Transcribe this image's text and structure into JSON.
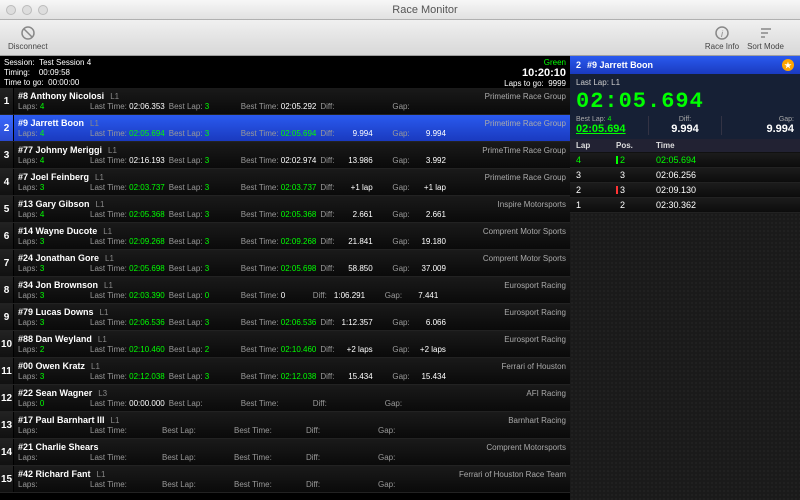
{
  "app": {
    "title": "Race Monitor"
  },
  "toolbar": {
    "disconnect": "Disconnect",
    "raceInfo": "Race Info",
    "sortMode": "Sort Mode"
  },
  "session": {
    "nameLbl": "Session:",
    "name": "Test Session 4",
    "timingLbl": "Timing:",
    "timing": "00:09:58",
    "ttgLbl": "Time to go:",
    "ttg": "00:00:00",
    "flag": "Green",
    "clock": "10:20:10",
    "lapsToGoLbl": "Laps to go:",
    "lapsToGo": "9999"
  },
  "cols": {
    "laps": "Laps:",
    "lastTime": "Last Time:",
    "bestLap": "Best Lap:",
    "bestTime": "Best Time:",
    "diff": "Diff:",
    "gap": "Gap:"
  },
  "rows": [
    {
      "pos": "1",
      "num": "#8",
      "driver": "Anthony Nicolosi",
      "l": "L1",
      "team": "Primetime Race Group",
      "laps": "4",
      "lt": "02:06.353",
      "bl": "3",
      "bt": "02:05.292",
      "diff": "",
      "gap": ""
    },
    {
      "pos": "2",
      "num": "#9",
      "driver": "Jarrett Boon",
      "l": "L1",
      "team": "Primetime Race Group",
      "laps": "4",
      "lt": "02:05.694",
      "ltG": true,
      "bl": "3",
      "bt": "02:05.694",
      "btG": true,
      "diff": "9.994",
      "gap": "9.994",
      "sel": true
    },
    {
      "pos": "3",
      "num": "#77",
      "driver": "Johnny Meriggi",
      "l": "L1",
      "team": "PrimeTime Race Group",
      "laps": "4",
      "lt": "02:16.193",
      "bl": "3",
      "bt": "02:02.974",
      "diff": "13.986",
      "gap": "3.992"
    },
    {
      "pos": "4",
      "num": "#7",
      "driver": "Joel Feinberg",
      "l": "L1",
      "team": "Primetime Race Group",
      "laps": "3",
      "lt": "02:03.737",
      "ltG": true,
      "bl": "3",
      "bt": "02:03.737",
      "btG": true,
      "diff": "+1 lap",
      "gap": "+1 lap"
    },
    {
      "pos": "5",
      "num": "#13",
      "driver": "Gary Gibson",
      "l": "L1",
      "team": "Inspire Motorsports",
      "laps": "4",
      "lt": "02:05.368",
      "ltG": true,
      "bl": "3",
      "bt": "02:05.368",
      "btG": true,
      "diff": "2.661",
      "gap": "2.661"
    },
    {
      "pos": "6",
      "num": "#14",
      "driver": "Wayne Ducote",
      "l": "L1",
      "team": "Comprent Motor Sports",
      "laps": "3",
      "lt": "02:09.268",
      "ltG": true,
      "bl": "3",
      "bt": "02:09.268",
      "btG": true,
      "diff": "21.841",
      "gap": "19.180"
    },
    {
      "pos": "7",
      "num": "#24",
      "driver": "Jonathan Gore",
      "l": "L1",
      "team": "Comprent Motor Sports",
      "laps": "3",
      "lt": "02:05.698",
      "ltG": true,
      "bl": "3",
      "bt": "02:05.698",
      "btG": true,
      "diff": "58.850",
      "gap": "37.009"
    },
    {
      "pos": "8",
      "num": "#34",
      "driver": "Jon Brownson",
      "l": "L1",
      "team": "Eurosport Racing",
      "laps": "3",
      "lt": "02:03.390",
      "ltG": true,
      "bl": "0",
      "bt": "0",
      "diff": "1:06.291",
      "gap": "7.441"
    },
    {
      "pos": "9",
      "num": "#79",
      "driver": "Lucas Downs",
      "l": "L1",
      "team": "Eurosport Racing",
      "laps": "3",
      "lt": "02:06.536",
      "ltG": true,
      "bl": "3",
      "bt": "02:06.536",
      "btG": true,
      "diff": "1:12.357",
      "gap": "6.066"
    },
    {
      "pos": "10",
      "num": "#88",
      "driver": "Dan Weyland",
      "l": "L1",
      "team": "Eurosport Racing",
      "laps": "2",
      "lt": "02:10.460",
      "ltG": true,
      "bl": "2",
      "bt": "02:10.460",
      "btG": true,
      "diff": "+2 laps",
      "gap": "+2 laps"
    },
    {
      "pos": "11",
      "num": "#00",
      "driver": "Owen Kratz",
      "l": "L1",
      "team": "Ferrari of Houston",
      "laps": "3",
      "lt": "02:12.038",
      "ltG": true,
      "bl": "3",
      "bt": "02:12.038",
      "btG": true,
      "diff": "15.434",
      "gap": "15.434"
    },
    {
      "pos": "12",
      "num": "#22",
      "driver": "Sean Wagner",
      "l": "L3",
      "team": "AFI Racing",
      "laps": "0",
      "lt": "00:00.000",
      "bl": "",
      "bt": "",
      "diff": "",
      "gap": ""
    },
    {
      "pos": "13",
      "num": "#17",
      "driver": "Paul Barnhart III",
      "l": "L1",
      "team": "Barnhart Racing",
      "laps": "",
      "lt": "",
      "bl": "",
      "bt": "",
      "diff": "",
      "gap": ""
    },
    {
      "pos": "14",
      "num": "#21",
      "driver": "Charlie Shears",
      "l": "",
      "team": "Comprent Motorsports",
      "laps": "",
      "lt": "",
      "bl": "",
      "bt": "",
      "diff": "",
      "gap": ""
    },
    {
      "pos": "15",
      "num": "#42",
      "driver": "Richard Fant",
      "l": "L1",
      "team": "Ferrari of Houston Race Team",
      "laps": "",
      "lt": "",
      "bl": "",
      "bt": "",
      "diff": "",
      "gap": ""
    }
  ],
  "detail": {
    "pos": "2",
    "num": "#9",
    "driver": "Jarrett Boon",
    "lastLapLbl": "Last Lap:",
    "lastLapLine": "L1",
    "bigTime": "02:05.694",
    "bestLapLbl": "Best Lap:",
    "bestLapN": "4",
    "bestLapT": "02:05.694",
    "diffLbl": "Diff:",
    "diff": "9.994",
    "gapLbl": "Gap:",
    "gap": "9.994",
    "hdr": {
      "lap": "Lap",
      "pos": "Pos.",
      "time": "Time"
    },
    "laps": [
      {
        "lap": "4",
        "pos": "2",
        "dir": "up",
        "time": "02:05.694",
        "best": true
      },
      {
        "lap": "3",
        "pos": "3",
        "dir": "",
        "time": "02:06.256"
      },
      {
        "lap": "2",
        "pos": "3",
        "dir": "down",
        "time": "02:09.130"
      },
      {
        "lap": "1",
        "pos": "2",
        "dir": "",
        "time": "02:30.362"
      }
    ]
  }
}
